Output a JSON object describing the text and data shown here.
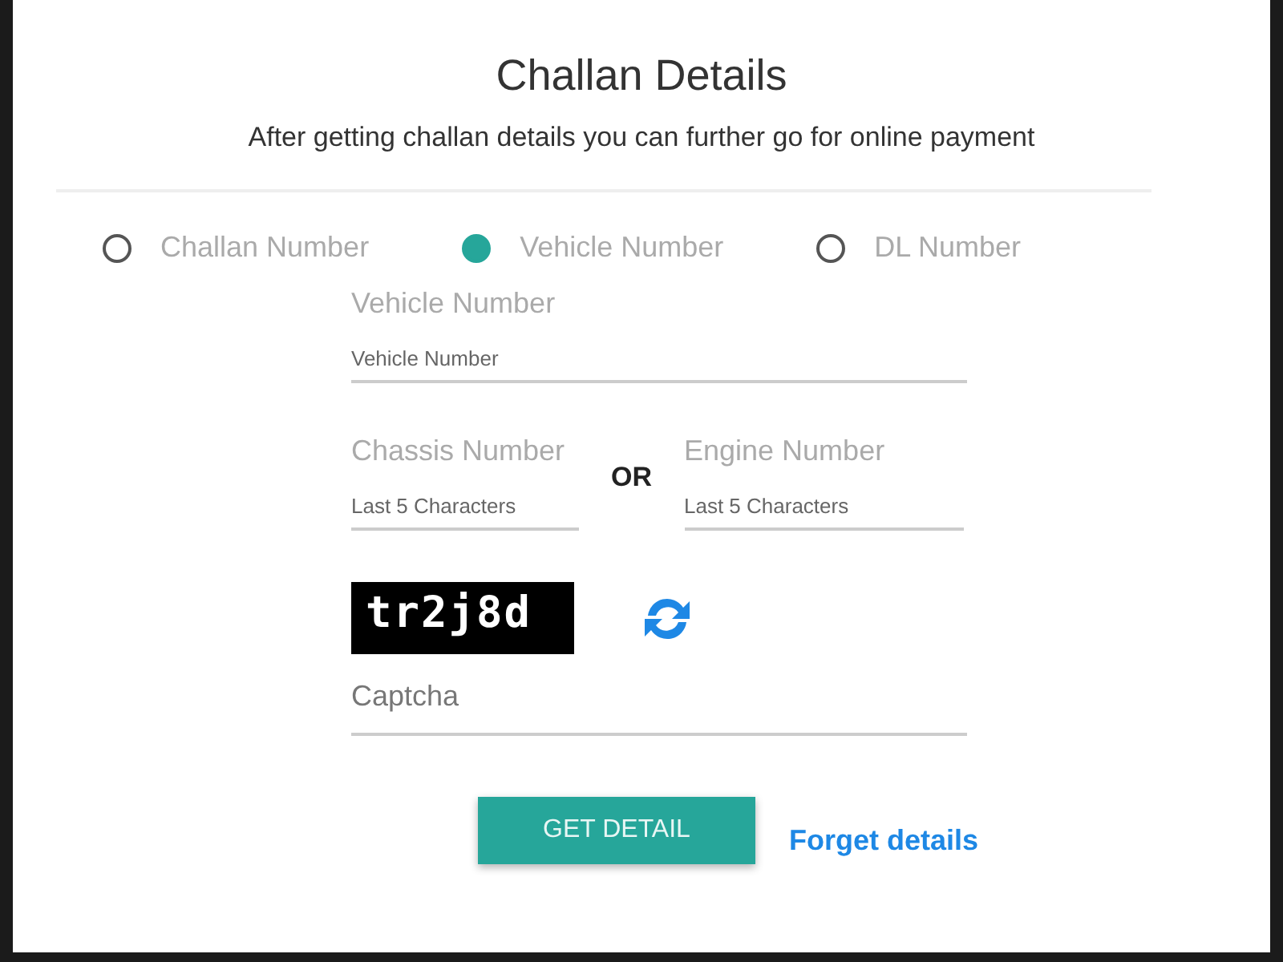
{
  "title": "Challan Details",
  "subtitle": "After getting challan details you can further go for online payment",
  "search_by": [
    {
      "label": "Challan Number",
      "selected": false
    },
    {
      "label": "Vehicle Number",
      "selected": true
    },
    {
      "label": "DL Number",
      "selected": false
    }
  ],
  "vehicle_field": {
    "label": "Vehicle Number",
    "placeholder": "Vehicle Number"
  },
  "chassis_field": {
    "label": "Chassis Number",
    "placeholder": "Last 5 Characters"
  },
  "separator": "OR",
  "engine_field": {
    "label": "Engine Number",
    "placeholder": "Last 5 Characters"
  },
  "captcha_image": {
    "text": "tr2j8d"
  },
  "captcha_field": {
    "placeholder": "Captcha"
  },
  "buttons": {
    "submit": "GET DETAIL",
    "link": "Forget details"
  }
}
